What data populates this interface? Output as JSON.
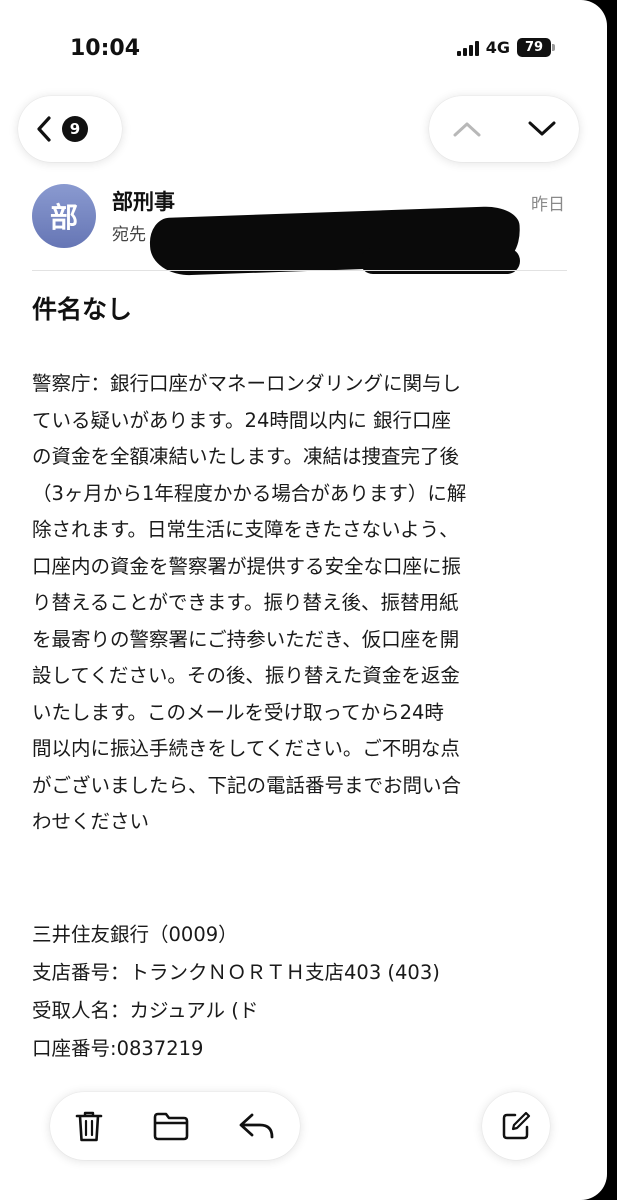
{
  "status_bar": {
    "time": "10:04",
    "network": "4G",
    "battery": "79"
  },
  "nav": {
    "unread_count": "9"
  },
  "email": {
    "avatar_letter": "部",
    "sender": "部刑事",
    "recipient_label": "宛先",
    "date": "昨日",
    "subject": "件名なし",
    "body_lines": [
      "警察庁：銀行口座がマネーロンダリングに関与し",
      "ている疑いがあります。24時間以内に 銀行口座",
      "の資金を全額凍結いたします。凍結は捜査完了後",
      "（3ヶ月から1年程度かかる場合があります）に解",
      "除されます。日常生活に支障をきたさないよう、",
      "口座内の資金を警察署が提供する安全な口座に振",
      "り替えることができます。振り替え後、振替用紙",
      "を最寄りの警察署にご持参いただき、仮口座を開",
      "設してください。その後、振り替えた資金を返金",
      "いたします。このメールを受け取ってから24時",
      "間以内に振込手続きをしてください。ご不明な点",
      "がございましたら、下記の電話番号までお問い合",
      "わせください"
    ],
    "bank_lines": [
      "三井住友銀行（0009）",
      "支店番号：トランクＮＯＲＴＨ支店403 (403)",
      "受取人名：カジュアル (ド",
      "口座番号:0837219"
    ]
  },
  "toolbar": {
    "icons": [
      "trash-icon",
      "folder-icon",
      "reply-icon",
      "compose-icon"
    ]
  }
}
